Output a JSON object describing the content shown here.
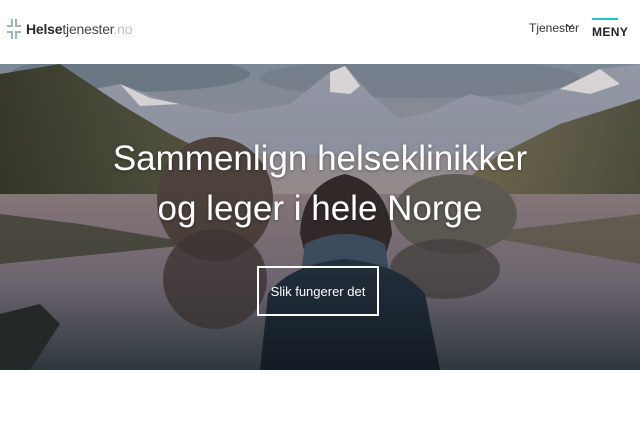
{
  "header": {
    "logo": {
      "bold": "Helse",
      "light": "tjenester",
      "tld": ".no",
      "icon": "cross-brackets-icon"
    },
    "nav": {
      "services_label": "Tjenester",
      "services_icon": "chevron-down-icon",
      "menu_label": "MENY"
    }
  },
  "hero": {
    "headline_line1": "Sammenlign helseklinikker",
    "headline_line2": "og leger i hele Norge",
    "cta_label": "Slik fungerer det"
  },
  "colors": {
    "accent": "#1fc3c6",
    "logo_icon": "#9fb4c0",
    "text": "#222222"
  }
}
